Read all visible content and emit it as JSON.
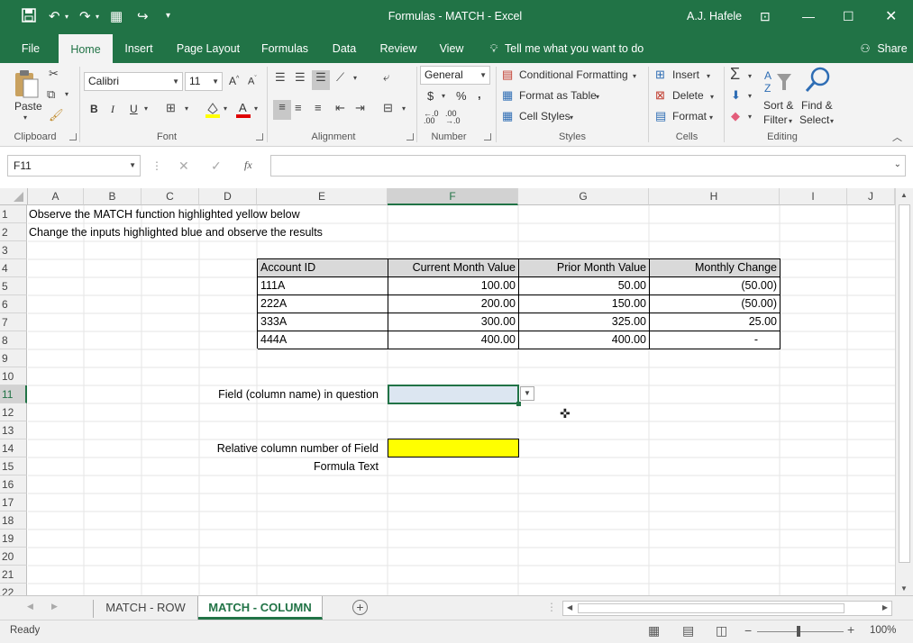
{
  "window": {
    "title": "Formulas - MATCH  -  Excel",
    "user": "A.J. Hafele"
  },
  "tabs": [
    "File",
    "Home",
    "Insert",
    "Page Layout",
    "Formulas",
    "Data",
    "Review",
    "View"
  ],
  "tell_me": "Tell me what you want to do",
  "share": "Share",
  "ribbon": {
    "clipboard": {
      "label": "Clipboard",
      "paste": "Paste"
    },
    "font": {
      "label": "Font",
      "name": "Calibri",
      "size": "11",
      "bold": "B",
      "italic": "I",
      "underline": "U"
    },
    "alignment": {
      "label": "Alignment"
    },
    "number": {
      "label": "Number",
      "format": "General",
      "currency": "$",
      "percent": "%",
      "comma": ","
    },
    "styles": {
      "label": "Styles",
      "conditional": "Conditional Formatting",
      "format_table": "Format as Table",
      "cell_styles": "Cell Styles"
    },
    "cells": {
      "label": "Cells",
      "insert": "Insert",
      "delete": "Delete",
      "format": "Format"
    },
    "editing": {
      "label": "Editing",
      "sort": "Sort &",
      "filter": "Filter",
      "find": "Find &",
      "select": "Select"
    }
  },
  "formula_bar": {
    "name_box": "F11",
    "fx": "fx",
    "value": ""
  },
  "columns": [
    "A",
    "B",
    "C",
    "D",
    "E",
    "F",
    "G",
    "H",
    "I",
    "J"
  ],
  "rows": [
    "1",
    "2",
    "3",
    "4",
    "5",
    "6",
    "7",
    "8",
    "9",
    "10",
    "11",
    "12",
    "13",
    "14",
    "15",
    "16",
    "17",
    "18",
    "19",
    "20",
    "21",
    "22"
  ],
  "cells": {
    "a1": "Observe the MATCH function highlighted yellow below",
    "a2": "Change the inputs highlighted blue and observe the results",
    "e11": "Field (column name) in question",
    "e14": "Relative column number of Field",
    "e15": "Formula Text"
  },
  "table": {
    "headers": [
      "Account ID",
      "Current Month Value",
      "Prior Month Value",
      "Monthly Change"
    ],
    "rows": [
      [
        "111A",
        "100.00",
        "50.00",
        "(50.00)"
      ],
      [
        "222A",
        "200.00",
        "150.00",
        "(50.00)"
      ],
      [
        "333A",
        "300.00",
        "325.00",
        "25.00"
      ],
      [
        "444A",
        "400.00",
        "400.00",
        "-"
      ]
    ]
  },
  "sheets": [
    "MATCH - ROW",
    "MATCH - COLUMN"
  ],
  "status": {
    "ready": "Ready",
    "zoom": "100%"
  },
  "colors": {
    "accent": "#217346",
    "input_blue": "#dce6f1",
    "output_yellow": "#ffff00"
  }
}
